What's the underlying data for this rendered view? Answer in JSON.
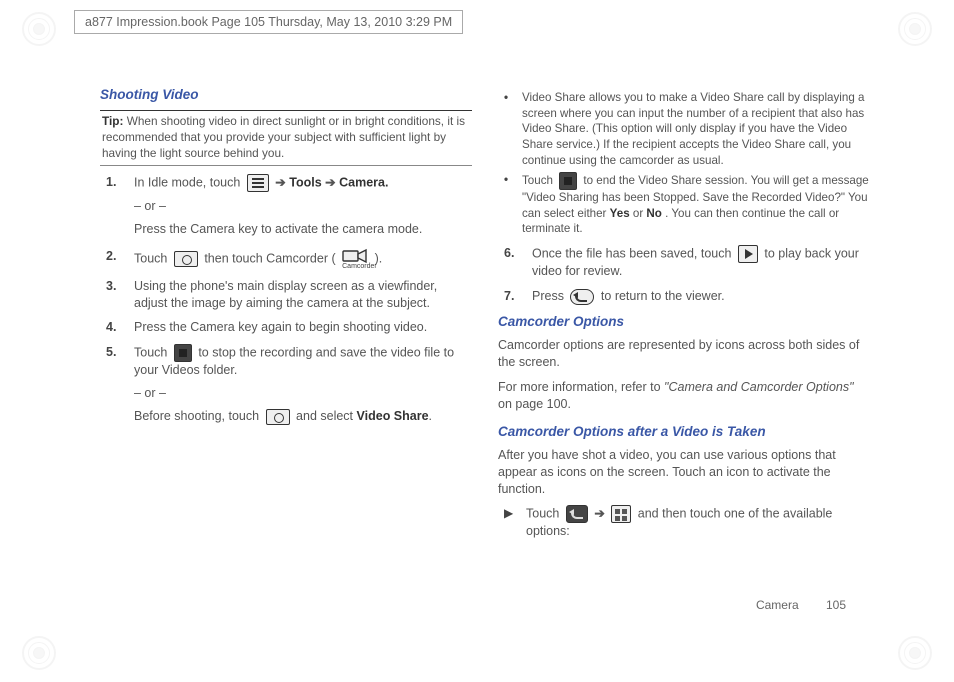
{
  "header": {
    "crop": "a877 Impression.book  Page 105  Thursday, May 13, 2010  3:29 PM"
  },
  "footer": {
    "section": "Camera",
    "page": "105"
  },
  "left": {
    "title": "Shooting Video",
    "tip_label": "Tip:",
    "tip_body": "When shooting video in direct sunlight or in bright conditions, it is recommended that you provide your subject with sufficient light by having the light source behind you.",
    "s1": {
      "num": "1.",
      "a": "In Idle mode, touch ",
      "b": " Tools ",
      "c": " Camera.",
      "or": "– or –",
      "d": "Press the Camera key to activate the camera mode."
    },
    "s2": {
      "num": "2.",
      "a": "Touch ",
      "b": " then touch Camcorder ( ",
      "c": " )."
    },
    "s3": {
      "num": "3.",
      "a": "Using the phone's main display screen as a viewfinder, adjust the image by aiming the camera at the subject."
    },
    "s4": {
      "num": "4.",
      "a": "Press the Camera key again to begin shooting video."
    },
    "s5": {
      "num": "5.",
      "a": "Touch ",
      "b": " to stop the recording and save the video file to your Videos folder.",
      "or": "– or –",
      "c": "Before shooting, touch ",
      "d": " and select ",
      "e": "Video Share",
      "f": "."
    },
    "arrow": "➔"
  },
  "right": {
    "b1": "Video Share allows you to make a Video Share call by displaying a screen where you can input the number of a recipient that also has Video Share. (This option will only display if you have the Video Share service.) If the recipient accepts the Video Share call, you continue using the camcorder as usual.",
    "b2a": "Touch ",
    "b2b": " to end the Video Share session. You will get a message \"Video Sharing has been Stopped. Save the Recorded Video?\" You can select either ",
    "b2yes": "Yes",
    "b2or": " or ",
    "b2no": "No",
    "b2c": ". You can then continue the call or terminate it.",
    "s6": {
      "num": "6.",
      "a": "Once the file has been saved, touch ",
      "b": " to play back your video for review."
    },
    "s7": {
      "num": "7.",
      "a": "Press ",
      "b": " to return to the viewer."
    },
    "h2": "Camcorder Options",
    "p1": "Camcorder options are represented by icons across both sides of the screen.",
    "p2a": "For more information, refer to ",
    "p2b": "\"Camera and Camcorder Options\"",
    "p2c": " on page 100.",
    "h3": "Camcorder Options after a Video is Taken",
    "p3": "After you have shot a video, you can use various options that appear as icons on the screen. Touch an icon to activate the function.",
    "tria": "Touch ",
    "trib": " and then touch one of the available options:"
  },
  "icons": {
    "camcorder_label": "Camcorder"
  }
}
